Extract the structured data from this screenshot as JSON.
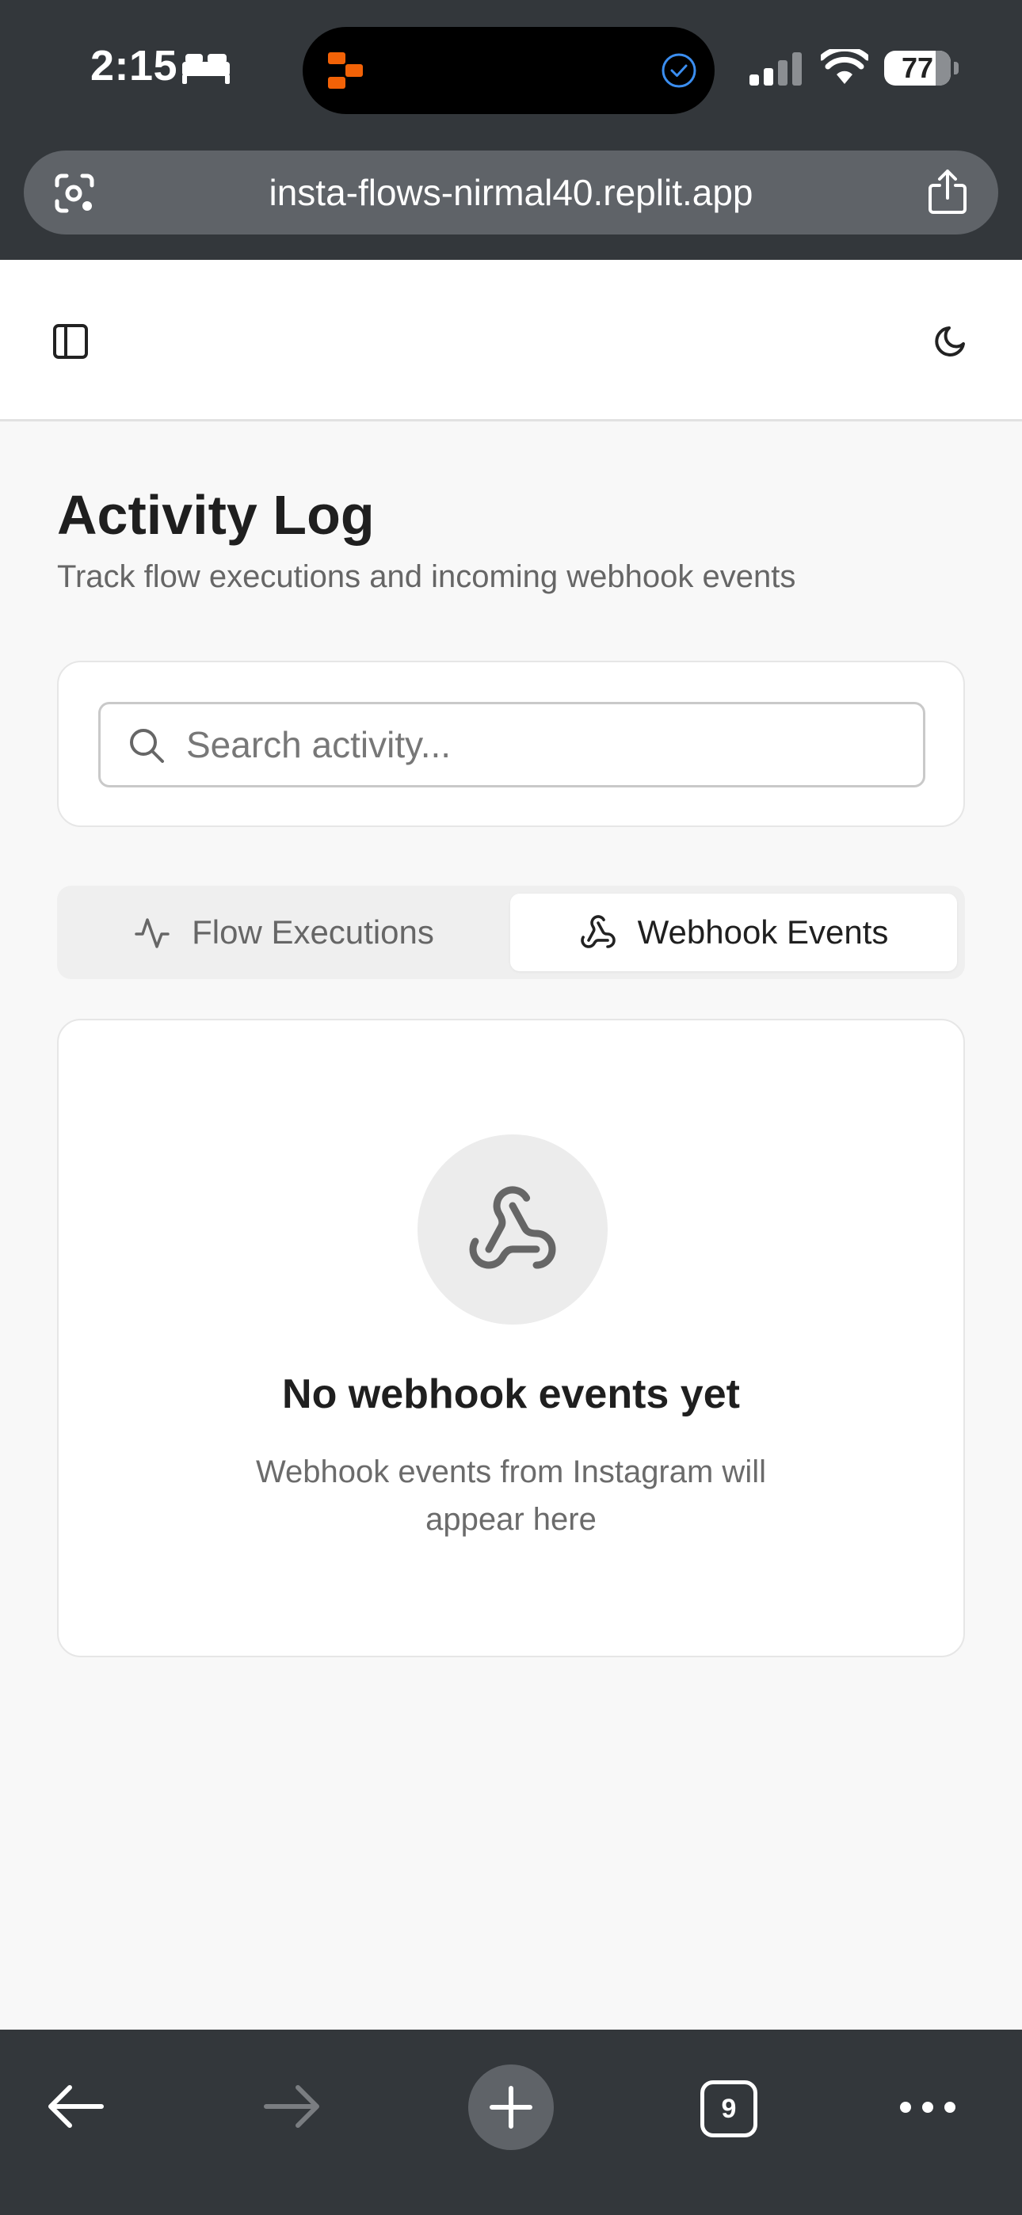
{
  "status_bar": {
    "time": "2:15",
    "battery_percent": "77",
    "battery_level": 0.77,
    "icons": [
      "bed-icon",
      "app-activity-icon",
      "check-circle-icon",
      "cellular-signal-icon",
      "wifi-icon",
      "battery-icon"
    ]
  },
  "browser": {
    "url": "insta-flows-nirmal40.replit.app",
    "tab_count": "9",
    "icons": [
      "lens-icon",
      "share-icon",
      "back-arrow-icon",
      "forward-arrow-icon",
      "plus-icon",
      "more-icon"
    ]
  },
  "header": {
    "icons": [
      "sidebar-toggle-icon",
      "moon-icon"
    ]
  },
  "page": {
    "title": "Activity Log",
    "subtitle": "Track flow executions and incoming webhook events"
  },
  "search": {
    "placeholder": "Search activity...",
    "value": ""
  },
  "tabs": [
    {
      "label": "Flow Executions",
      "icon": "activity-icon",
      "selected": false
    },
    {
      "label": "Webhook Events",
      "icon": "webhook-icon",
      "selected": true
    }
  ],
  "empty_state": {
    "icon": "webhook-icon",
    "title": "No webhook events yet",
    "description": "Webhook events from Instagram will appear here"
  },
  "colors": {
    "chrome_bg": "#33373b",
    "page_bg": "#f8f8f8",
    "app_icon_accent": "#f26207",
    "check_accent": "#3b8ef0"
  }
}
